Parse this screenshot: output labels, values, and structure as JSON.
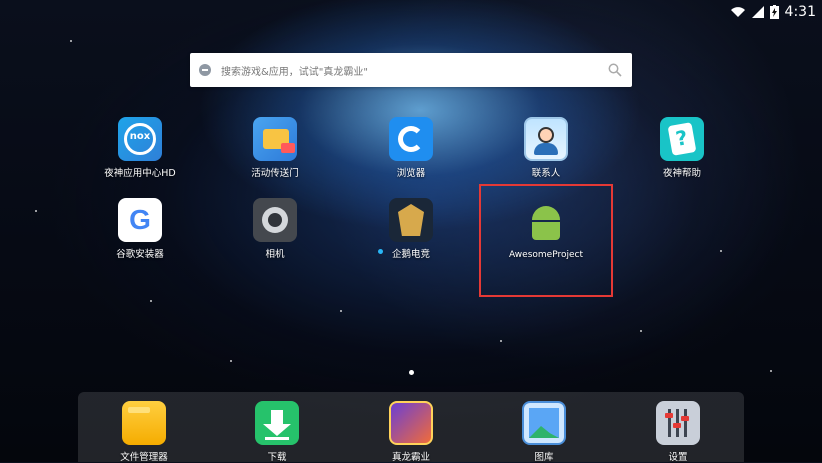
{
  "status_bar": {
    "time": "4:31",
    "icons": [
      "wifi-icon",
      "signal-icon",
      "battery-charging-icon"
    ]
  },
  "search": {
    "placeholder": "搜索游戏&应用，试试\"真龙霸业\"",
    "icon": "search-icon"
  },
  "apps": [
    {
      "label": "夜神应用中心HD",
      "icon": "nox-app-center-icon"
    },
    {
      "label": "活动传送门",
      "icon": "event-portal-icon"
    },
    {
      "label": "浏览器",
      "icon": "browser-icon"
    },
    {
      "label": "联系人",
      "icon": "contacts-icon"
    },
    {
      "label": "夜神帮助",
      "icon": "nox-help-icon"
    },
    {
      "label": "谷歌安装器",
      "icon": "google-installer-icon"
    },
    {
      "label": "相机",
      "icon": "camera-icon"
    },
    {
      "label": "企鹅电竞",
      "icon": "penguin-esports-icon"
    },
    {
      "label": "AwesomeProject",
      "icon": "android-icon"
    }
  ],
  "nox_icon_text": "nox",
  "google_letter": "G",
  "dock": [
    {
      "label": "文件管理器",
      "icon": "file-manager-icon"
    },
    {
      "label": "下载",
      "icon": "download-icon"
    },
    {
      "label": "真龙霸业",
      "icon": "game-icon"
    },
    {
      "label": "图库",
      "icon": "gallery-icon"
    },
    {
      "label": "设置",
      "icon": "settings-icon"
    }
  ],
  "colors": {
    "selection_border": "#e53935",
    "new_dot": "#29b6f6",
    "page_dot": "#ffffff"
  }
}
